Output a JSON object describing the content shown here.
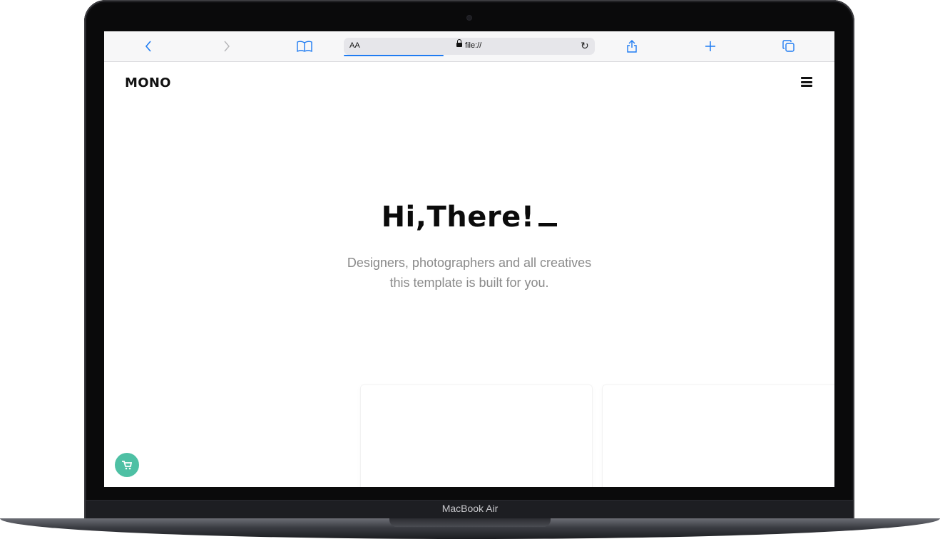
{
  "device": {
    "model_label": "MacBook Air"
  },
  "browser": {
    "reader_label": "AA",
    "url": "file://",
    "icons": [
      "back-icon",
      "forward-icon",
      "bookmarks-icon",
      "reload-icon",
      "share-icon",
      "new-tab-icon",
      "tabs-icon"
    ]
  },
  "site": {
    "brand": "MONO",
    "hero": {
      "title": "Hi,There!",
      "subtitle_line1": "Designers, photographers and all creatives",
      "subtitle_line2": "this template is built for you."
    },
    "accent_color": "#4ec0a4"
  }
}
